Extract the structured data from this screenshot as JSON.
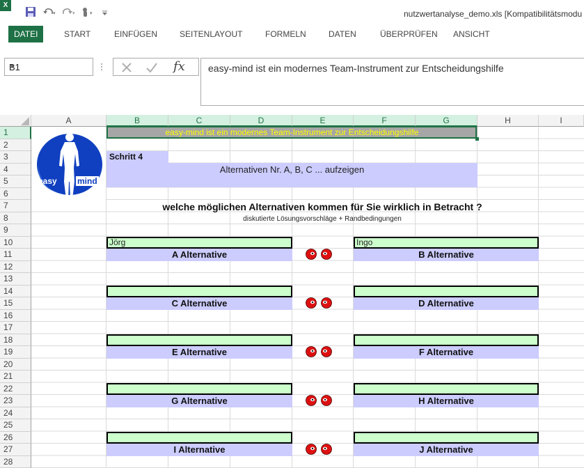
{
  "title_bar": {
    "title": "nutzwertanalyse_demo.xls  [Kompatibilitätsmodu"
  },
  "ribbon": {
    "tabs": [
      "DATEI",
      "START",
      "EINFÜGEN",
      "SEITENLAYOUT",
      "FORMELN",
      "DATEN",
      "ÜBERPRÜFEN",
      "ANSICHT"
    ],
    "active_tab": "DATEI"
  },
  "formula_bar": {
    "name_box": "B1",
    "fx_label": "fx",
    "content": "easy-mind ist ein modernes Team-Instrument zur Entscheidungshilfe"
  },
  "columns": [
    "A",
    "B",
    "C",
    "D",
    "E",
    "F",
    "G",
    "H",
    "I"
  ],
  "selected_column": "B",
  "rows": [
    "1",
    "2",
    "3",
    "4",
    "5",
    "6",
    "7",
    "8",
    "9",
    "10",
    "11",
    "12",
    "13",
    "14",
    "15",
    "16",
    "17",
    "18",
    "19",
    "20",
    "21",
    "22",
    "23",
    "24",
    "25",
    "26",
    "27",
    "28"
  ],
  "selected_row": "1",
  "logo": {
    "text_left": "easy",
    "text_right": "mind"
  },
  "sheet": {
    "header_banner": "easy-mind ist ein modernes Team-Instrument zur Entscheidungshilfe",
    "step_label": "Schritt 4",
    "step_desc": "Alternativen Nr. A, B, C ... aufzeigen",
    "question": "welche möglichen Alternativen kommen für Sie wirklich in Betracht ?",
    "subtitle": "diskutierte Lösungsvorschläge + Randbedingungen",
    "pairs": [
      {
        "left_name": "Jörg",
        "left_alt": "A Alternative",
        "right_name": "Ingo",
        "right_alt": "B Alternative"
      },
      {
        "left_name": "",
        "left_alt": "C Alternative",
        "right_name": "",
        "right_alt": "D Alternative"
      },
      {
        "left_name": "",
        "left_alt": "E Alternative",
        "right_name": "",
        "right_alt": "F Alternative"
      },
      {
        "left_name": "",
        "left_alt": "G Alternative",
        "right_name": "",
        "right_alt": "H Alternative"
      },
      {
        "left_name": "",
        "left_alt": "I Alternative",
        "right_name": "",
        "right_alt": "J Alternative"
      }
    ]
  },
  "colors": {
    "excel_green": "#1e7145",
    "banner_fill": "#a6a6a6",
    "banner_text": "#ffff00",
    "lavender": "#ccccff",
    "input_green": "#ccffcc",
    "ball_red": "#dd1111"
  },
  "icons": [
    "excel-icon",
    "save-icon",
    "undo-icon",
    "redo-icon",
    "touch-mode-icon",
    "customize-qat-icon",
    "cancel-icon",
    "enter-icon",
    "fx-icon",
    "easy-mind-logo",
    "red-ball-icon"
  ]
}
